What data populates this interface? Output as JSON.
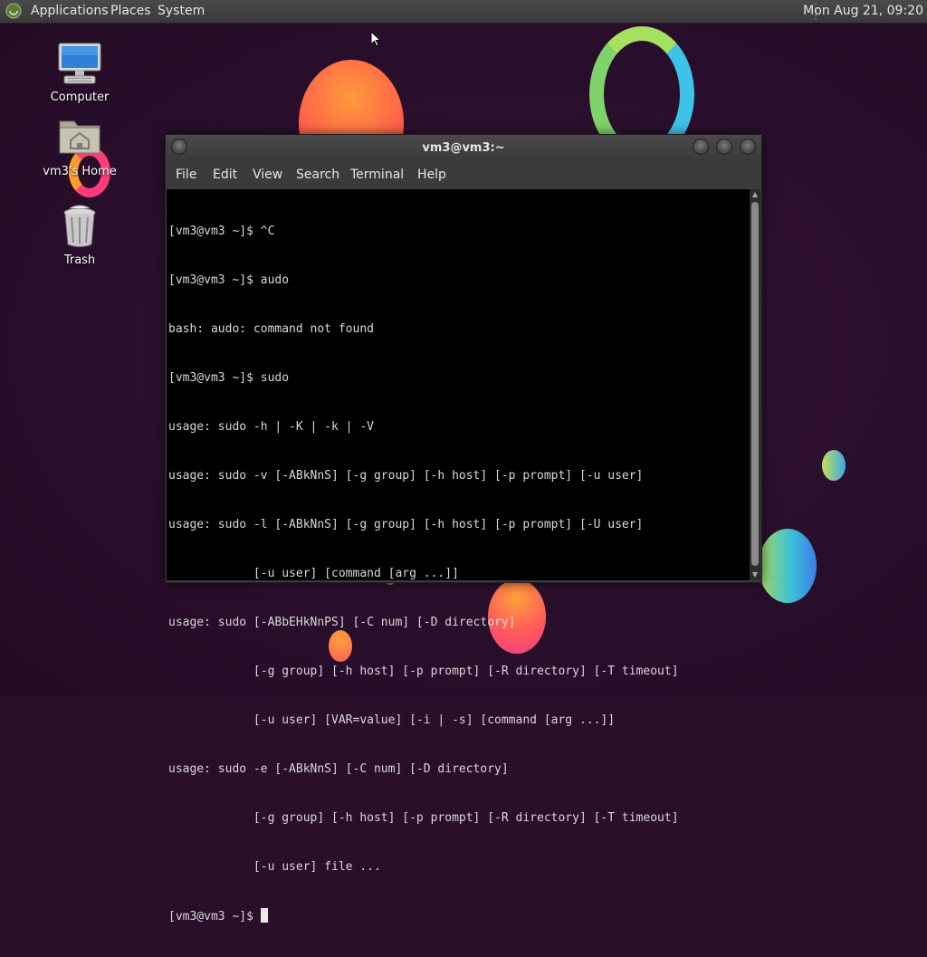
{
  "panel": {
    "menus": [
      "Applications",
      "Places",
      "System"
    ],
    "clock": "Mon Aug 21, 09:20",
    "logo_icon": "mate-logo-icon"
  },
  "desktop_icons": [
    {
      "label": "Computer",
      "icon": "computer-icon"
    },
    {
      "label": "vm3's Home",
      "icon": "home-folder-icon"
    },
    {
      "label": "Trash",
      "icon": "trash-icon"
    }
  ],
  "terminal": {
    "title": "vm3@vm3:~",
    "menus": [
      "File",
      "Edit",
      "View",
      "Search",
      "Terminal",
      "Help"
    ],
    "lines": [
      "[vm3@vm3 ~]$ ^C",
      "[vm3@vm3 ~]$ audo",
      "bash: audo: command not found",
      "[vm3@vm3 ~]$ sudo",
      "usage: sudo -h | -K | -k | -V",
      "usage: sudo -v [-ABkNnS] [-g group] [-h host] [-p prompt] [-u user]",
      "usage: sudo -l [-ABkNnS] [-g group] [-h host] [-p prompt] [-U user]",
      "            [-u user] [command [arg ...]]",
      "usage: sudo [-ABbEHkNnPS] [-C num] [-D directory]",
      "            [-g group] [-h host] [-p prompt] [-R directory] [-T timeout]",
      "            [-u user] [VAR=value] [-i | -s] [command [arg ...]]",
      "usage: sudo -e [-ABkNnS] [-C num] [-D directory]",
      "            [-g group] [-h host] [-p prompt] [-R directory] [-T timeout]",
      "            [-u user] file ..."
    ],
    "prompt": "[vm3@vm3 ~]$ "
  },
  "colors": {
    "panel_bg": "#3f3f3f",
    "desktop_bg": "#2a0f2b",
    "terminal_bg": "#000000",
    "terminal_fg": "#d8d8d8"
  }
}
